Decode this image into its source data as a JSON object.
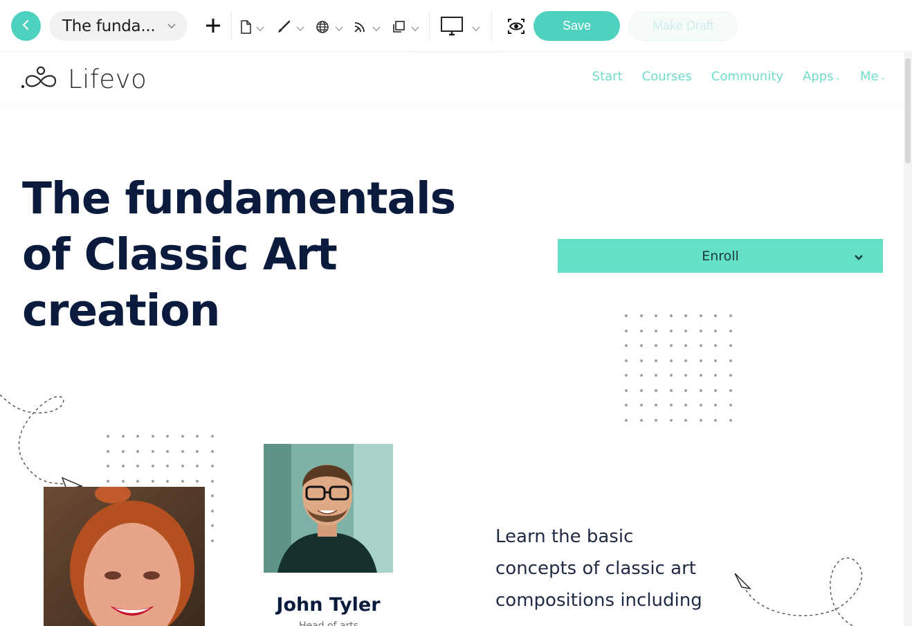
{
  "toolbar": {
    "page_title": "The funda...",
    "save_label": "Save",
    "draft_label": "Make Draft",
    "icons": [
      "back-icon",
      "chevron-down-icon",
      "plus-icon",
      "page-icon",
      "brush-icon",
      "globe-icon",
      "feed-icon",
      "copy-icon",
      "monitor-icon",
      "preview-eye-icon",
      "collapse-up-icon"
    ],
    "accent_color": "#4fd1bf"
  },
  "site": {
    "logo_text": "Lifevo",
    "nav": [
      {
        "label": "Start"
      },
      {
        "label": "Courses"
      },
      {
        "label": "Community"
      },
      {
        "label": "Apps"
      },
      {
        "label": "Me"
      }
    ],
    "nav_color": "#6fdccb"
  },
  "hero": {
    "title_line1": "The fundamentals",
    "title_line2": "of Classic Art",
    "title_line3": "creation",
    "enroll_label": "Enroll",
    "enroll_color": "#63e0c5"
  },
  "instructor": {
    "name": "John Tyler",
    "role": "Head of arts"
  },
  "description": {
    "line1": "Learn the basic",
    "line2": "concepts of classic art",
    "line3": "compositions including"
  }
}
